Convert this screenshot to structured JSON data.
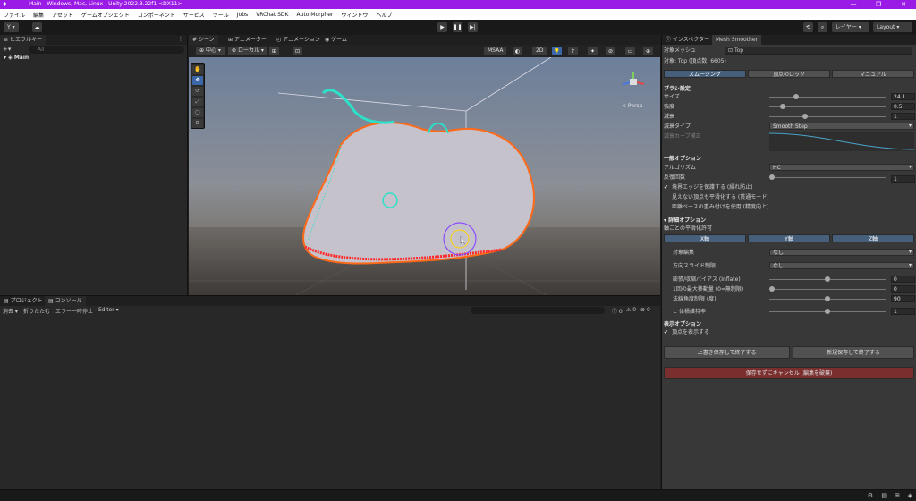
{
  "titlebar": {
    "title": " - Main - Windows, Mac, Linux - Unity 2022.3.22f1 <DX11>",
    "minimize": "—",
    "maximize": "❐",
    "close": "✕"
  },
  "menu": [
    "ファイル",
    "編集",
    "アセット",
    "ゲームオブジェクト",
    "コンポーネント",
    "サービス",
    "ツール",
    "Jobs",
    "VRChat SDK",
    "Auto Morpher",
    "ウィンドウ",
    "ヘルプ"
  ],
  "toolbar": {
    "account": "Y ▾",
    "layers": "レイヤー",
    "layout": "Layout"
  },
  "hierarchy": {
    "tab": "ヒエラルキー",
    "search_placeholder": "All",
    "root": "Main"
  },
  "scene": {
    "tabs": [
      "シーン",
      "アニメーター",
      "アニメーション",
      "ゲーム"
    ],
    "pivot": "中心",
    "space": "ローカル",
    "msaa": "MSAA",
    "mode2d": "2D",
    "persp": "< Persp"
  },
  "console": {
    "tabs": [
      "プロジェクト",
      "コンソール"
    ],
    "clear": "消去",
    "collapse": "折りたたむ",
    "error_pause": "エラー一時停止",
    "editor": "Editor",
    "counts": [
      "0",
      "0",
      "0"
    ]
  },
  "inspector": {
    "tabs": [
      "インスペクター",
      "Mesh Smoother"
    ],
    "target_label": "対象メッシュ",
    "target_value": "Top",
    "target_info": "対象: Top (頂点数: 6605)",
    "mode_tabs": [
      "スムージング",
      "頂点のロック",
      "マニュアル"
    ],
    "brush_section": "ブラシ設定",
    "size_label": "サイズ",
    "size_value": "24.1",
    "size_pos": 0.22,
    "strength_label": "強度",
    "strength_value": "0.5",
    "strength_pos": 0.1,
    "falloff_label": "減衰",
    "falloff_value": "1",
    "falloff_pos": 0.3,
    "falloff_type_label": "減衰タイプ",
    "falloff_type_value": "Smooth Step",
    "falloff_curve_label": "減衰カーブ補正",
    "general_section": "一般オプション",
    "algorithm_label": "アルゴリズム",
    "algorithm_value": "HC",
    "iterations_label": "反復回数",
    "iterations_value": "1",
    "iterations_pos": 0.0,
    "opt1": "境界エッジを保護する (縁れ防止)",
    "opt2": "見えない頂点も平滑化する (貫通モード)",
    "opt3": "距離ベースの重み付けを使用 (精度向上)",
    "detail_section": "詳細オプション",
    "axis_label": "軸ごとの平滑化許可",
    "axes": [
      "X軸",
      "Y軸",
      "Z軸"
    ],
    "edit_target_label": "対象編集",
    "edit_target_value": "なし",
    "dir_limit_label": "方向スライド制限",
    "dir_limit_value": "なし",
    "inflate_label": "膨張/収縮バイアス (Inflate)",
    "inflate_value": "0",
    "inflate_pos": 0.5,
    "maxmove_label": "1回の最大移動量 (0=無制限)",
    "maxmove_value": "0",
    "maxmove_pos": 0.0,
    "normal_label": "法線角度制限 (度)",
    "normal_value": "90",
    "normal_pos": 0.5,
    "volume_label": "体積維持率",
    "volume_value": "1",
    "volume_pos": 0.5,
    "display_section": "表示オプション",
    "show_verts": "頂点を表示する",
    "save_overwrite": "上書き保存して終了する",
    "save_new": "新規保存して終了する",
    "discard": "保存せずにキャンセル (編集を破棄)"
  },
  "colors": {
    "title": "#9a1ae6",
    "discard": "#7a2e2e",
    "selected_tab": "#46607c"
  }
}
